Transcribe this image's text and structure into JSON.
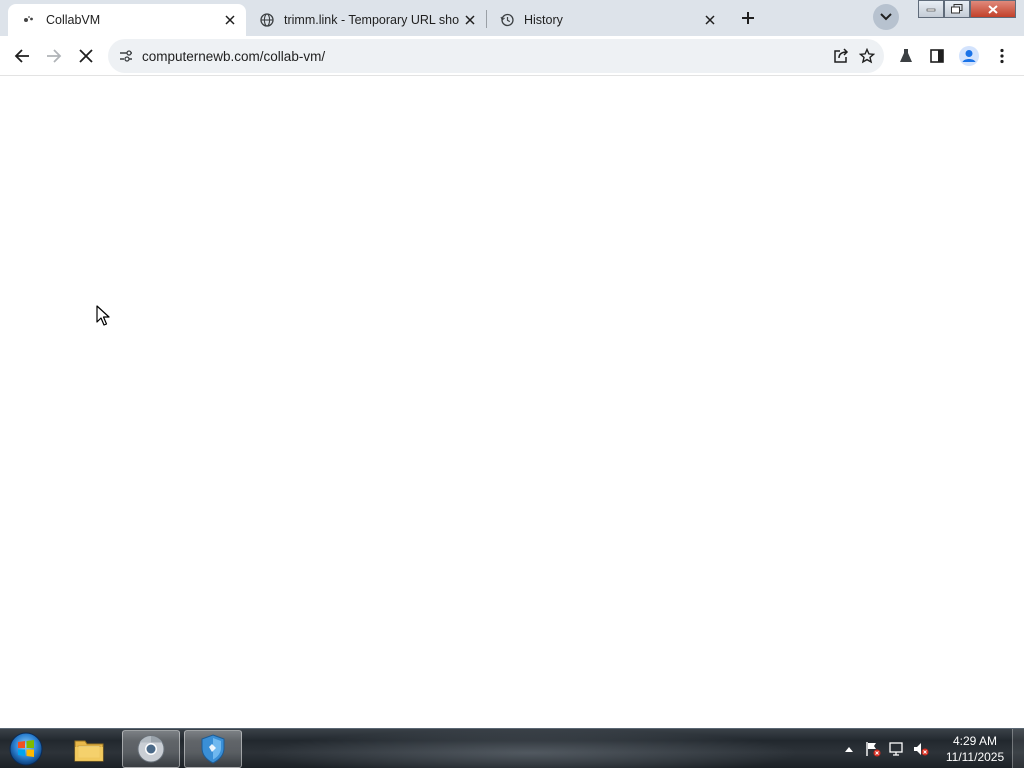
{
  "browser": {
    "tabs": [
      {
        "title": "CollabVM",
        "active": true,
        "icon": "loading-dots-icon"
      },
      {
        "title": "trimm.link - Temporary URL sho",
        "active": false,
        "icon": "globe-icon"
      },
      {
        "title": "History",
        "active": false,
        "icon": "history-icon"
      }
    ],
    "address_bar": {
      "url": "computernewb.com/collab-vm/"
    },
    "loading": true
  },
  "taskbar": {
    "apps": [
      {
        "name": "Windows Explorer",
        "icon": "folder-icon"
      },
      {
        "name": "Google Chrome",
        "icon": "chrome-icon"
      },
      {
        "name": "Security Essentials",
        "icon": "shield-icon"
      }
    ],
    "clock": {
      "time": "4:29 AM",
      "date": "11/11/2025"
    }
  },
  "colors": {
    "tabstrip_bg": "#dde3ea",
    "omnibox_bg": "#eef1f4",
    "profile_accent": "#1a73e8"
  }
}
